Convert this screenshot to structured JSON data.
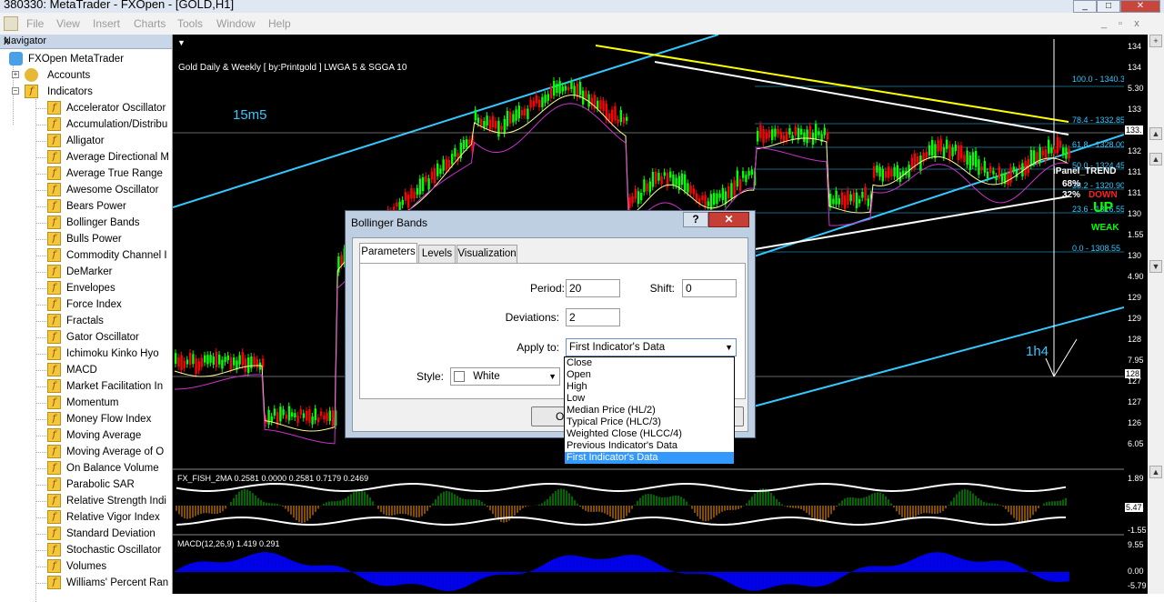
{
  "window": {
    "title": "380330: MetaTrader - FXOpen - [GOLD,H1]",
    "controls": [
      "_",
      "□",
      "✕"
    ]
  },
  "menubar": [
    "File",
    "View",
    "Insert",
    "Charts",
    "Tools",
    "Window",
    "Help"
  ],
  "navigator": {
    "title": "Navigator",
    "close_glyph": "x",
    "root": "FXOpen MetaTrader",
    "accounts": "Accounts",
    "indicators_label": "Indicators",
    "indicators": [
      "Accelerator Oscillator",
      "Accumulation/Distribu",
      "Alligator",
      "Average Directional M",
      "Average True Range",
      "Awesome Oscillator",
      "Bears Power",
      "Bollinger Bands",
      "Bulls Power",
      "Commodity Channel I",
      "DeMarker",
      "Envelopes",
      "Force Index",
      "Fractals",
      "Gator Oscillator",
      "Ichimoku Kinko Hyo",
      "MACD",
      "Market Facilitation In",
      "Momentum",
      "Money Flow Index",
      "Moving Average",
      "Moving Average of O",
      "On Balance Volume",
      "Parabolic SAR",
      "Relative Strength Indi",
      "Relative Vigor Index",
      "Standard Deviation",
      "Stochastic Oscillator",
      "Volumes",
      "Williams' Percent Ran"
    ]
  },
  "chart": {
    "header": "Gold Daily & Weekly [ by:Printgold ]  LWGA 5  &  SGGA 10",
    "label_15m5": "15m5",
    "label_1h4": "1h4",
    "fibo": [
      "100.0 - 1340.35",
      "78.4 - 1332.85",
      "61.8 - 1328.00",
      "50.0 - 1324.45",
      "38.2 - 1320.90",
      "23.6 - 1316.55",
      "0.0 - 1308.55"
    ],
    "ipanel": {
      "title": "iPanel_TREND",
      "pct1": "68%",
      "pct2": "32%",
      "down": "DOWN",
      "up": "UP",
      "weak": "WEAK"
    },
    "sub1_label": "FX_FISH_2MA 0.2581 0.0000 0.2581 0.7179 0.2469",
    "sub2_label": "MACD(12,26,9) 1.419 0.291",
    "price_ticks": [
      "134",
      "134",
      "5.30",
      "133",
      "132",
      "132",
      "131",
      "131",
      "130",
      "1.55",
      "130",
      "4.90",
      "129",
      "129",
      "128",
      "7.95",
      "127",
      "127",
      "126",
      "6.05"
    ],
    "price_tags": [
      "133.",
      "128"
    ],
    "sub1_ticks": [
      "1.89",
      "0.00",
      "-1.55"
    ],
    "sub1_tag": "5.47",
    "sub2_ticks": [
      "9.55",
      "0.00",
      "-5.79"
    ]
  },
  "dialog": {
    "title": "Bollinger Bands",
    "help": "?",
    "close": "✕",
    "tabs": [
      "Parameters",
      "Levels",
      "Visualization"
    ],
    "period_label": "Period:",
    "period": "20",
    "shift_label": "Shift:",
    "shift": "0",
    "deviations_label": "Deviations:",
    "deviations": "2",
    "apply_label": "Apply to:",
    "apply_value": "First Indicator's Data",
    "style_label": "Style:",
    "style_value": "White",
    "ok": "O",
    "apply_options": [
      "Close",
      "Open",
      "High",
      "Low",
      "Median Price (HL/2)",
      "Typical Price (HLC/3)",
      "Weighted Close (HLCC/4)",
      "Previous Indicator's Data",
      "First Indicator's Data"
    ],
    "selected_index": 8
  },
  "colors": {
    "chart_bg": "#000000",
    "bull": "#00ff00",
    "bear": "#ff0000",
    "trend_cyan": "#33c8ff",
    "trend_yellow": "#ffff00",
    "macd": "#0000ff",
    "accent": "#3399ff"
  }
}
